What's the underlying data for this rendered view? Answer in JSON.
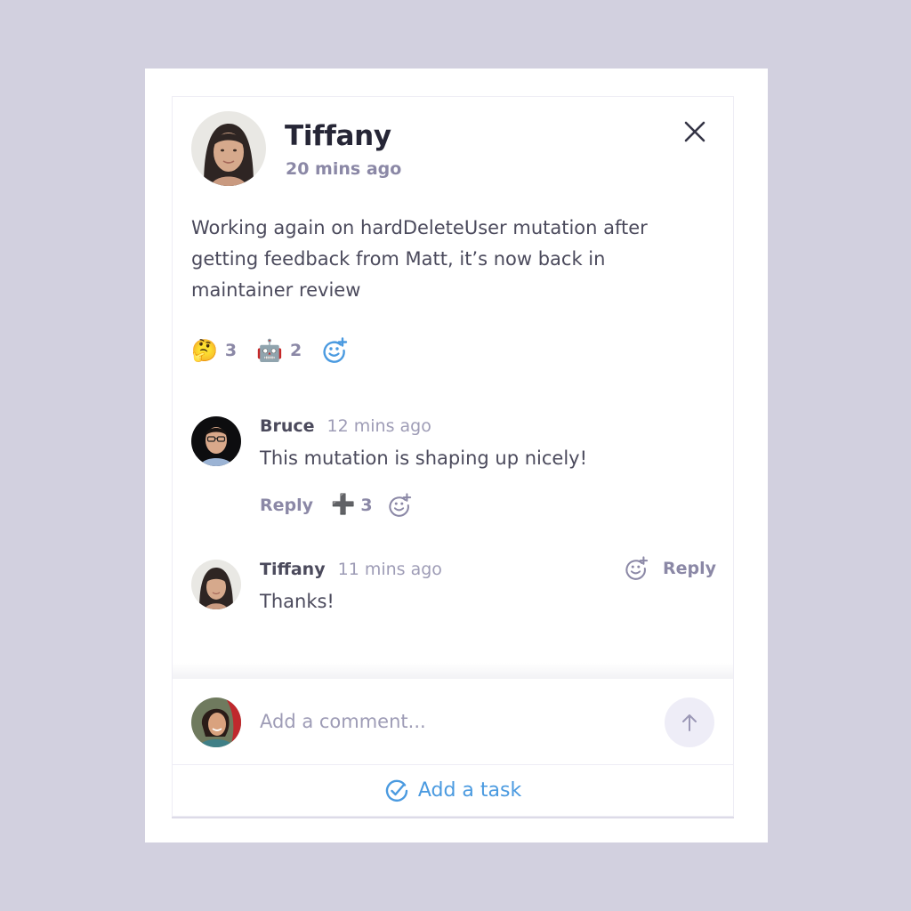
{
  "post": {
    "author": "Tiffany",
    "time": "20 mins ago",
    "body": "Working again on hardDeleteUser mutation after getting feedback from Matt, it’s now back in maintainer review",
    "reactions": [
      {
        "emoji": "🤔",
        "name": "thinking-face",
        "count": "3"
      },
      {
        "emoji": "🤖",
        "name": "robot",
        "count": "2"
      }
    ],
    "add_reaction_icon": "add-emoji-icon",
    "close_icon": "close-icon"
  },
  "comments": [
    {
      "author": "Bruce",
      "time": "12 mins ago",
      "text": "This mutation is shaping up nicely!",
      "reply_label": "Reply",
      "reaction": {
        "emoji": "➕",
        "count": "3"
      }
    },
    {
      "author": "Tiffany",
      "time": "11 mins ago",
      "text": "Thanks!",
      "reply_label": "Reply"
    }
  ],
  "composer": {
    "placeholder": "Add a comment...",
    "value": "",
    "send_icon": "arrow-up-icon"
  },
  "task": {
    "label": "Add a task",
    "icon": "check-circle-icon"
  },
  "colors": {
    "background": "#d2d0df",
    "accent": "#4a9ae0",
    "muted": "#8b88a6",
    "text": "#4b4a5c",
    "title": "#262636"
  }
}
